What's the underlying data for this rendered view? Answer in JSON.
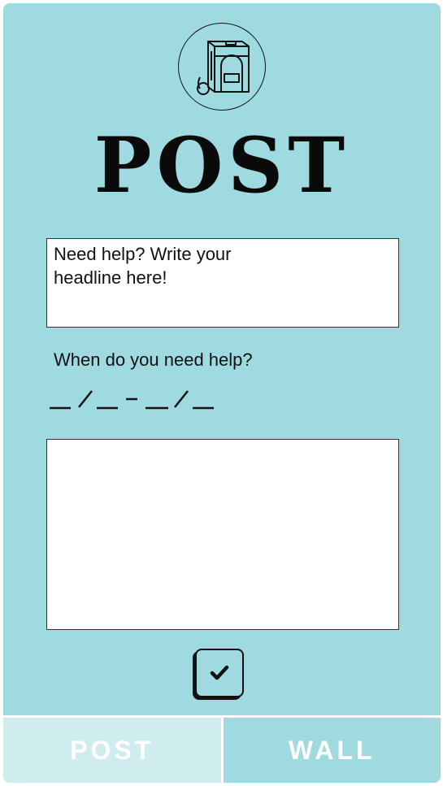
{
  "app": {
    "title": "POST",
    "logo_icon": "food-cart-icon",
    "colors": {
      "background": "#9fdae1",
      "active_tab": "#cfecef",
      "ink": "#111111",
      "field": "#ffffff"
    }
  },
  "form": {
    "headline_placeholder": "Need help? Write your headline here!",
    "when_label": "When do you need help?",
    "date_placeholder": "__/__ - __/__",
    "description_value": "",
    "confirm_icon": "checkmark-icon"
  },
  "tabs": [
    {
      "label": "POST",
      "active": true
    },
    {
      "label": "WALL",
      "active": false
    }
  ]
}
